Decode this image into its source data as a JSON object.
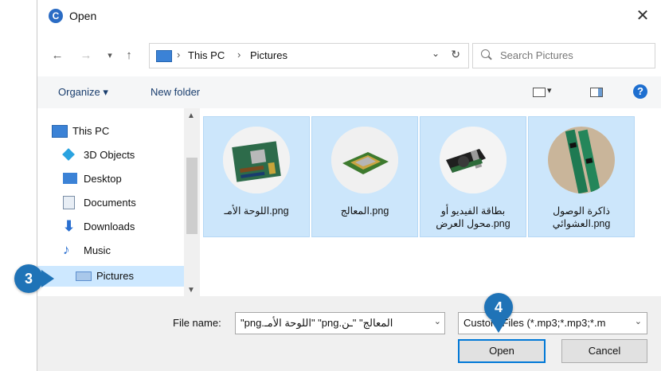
{
  "window": {
    "title": "Open",
    "close_glyph": "✕"
  },
  "nav": {
    "back": "←",
    "forward": "→",
    "recent": "▾",
    "up": "↑",
    "breadcrumb": [
      "This PC",
      "Pictures"
    ],
    "sep": "›",
    "dropdown": "⌄",
    "refresh": "↻",
    "search_placeholder": "Search Pictures"
  },
  "toolbar": {
    "organize": "Organize ▾",
    "new_folder": "New folder",
    "help": "?"
  },
  "sidebar": {
    "items": [
      {
        "label": "This PC",
        "icon": "computer-icon",
        "color": "#3b82d6"
      },
      {
        "label": "3D Objects",
        "icon": "cube-icon",
        "color": "#2aa3e0"
      },
      {
        "label": "Desktop",
        "icon": "desktop-icon",
        "color": "#3b82d6"
      },
      {
        "label": "Documents",
        "icon": "document-icon",
        "color": "#7a8ea6"
      },
      {
        "label": "Downloads",
        "icon": "download-icon",
        "color": "#2a6fd0"
      },
      {
        "label": "Music",
        "icon": "music-icon",
        "color": "#2a6fd0"
      },
      {
        "label": "Pictures",
        "icon": "pictures-icon",
        "color": "#5c8fcf",
        "selected": true
      }
    ]
  },
  "files": [
    {
      "label": "png.اللوحة الأمـ",
      "thumb": "motherboard"
    },
    {
      "label": "png.المعالج",
      "thumb": "processor"
    },
    {
      "label": "بطاقة الفيديو أو png.محول العرض",
      "thumb": "video-card"
    },
    {
      "label": "ذاكرة الوصول png.العشوائي",
      "thumb": "ram"
    }
  ],
  "bottom": {
    "file_name_label": "File name:",
    "file_name_value": "\"png.اللوحة الأمـ\" \"png.المعالج\" \"ـن",
    "file_type_value": "Custom Files (*.mp3;*.mp3;*.m",
    "open_label": "Open",
    "cancel_label": "Cancel"
  },
  "callouts": {
    "step3": "3",
    "step4": "4"
  },
  "colors": {
    "accent": "#0078d7",
    "selection": "#cce6fb",
    "callout": "#1f73b7"
  }
}
